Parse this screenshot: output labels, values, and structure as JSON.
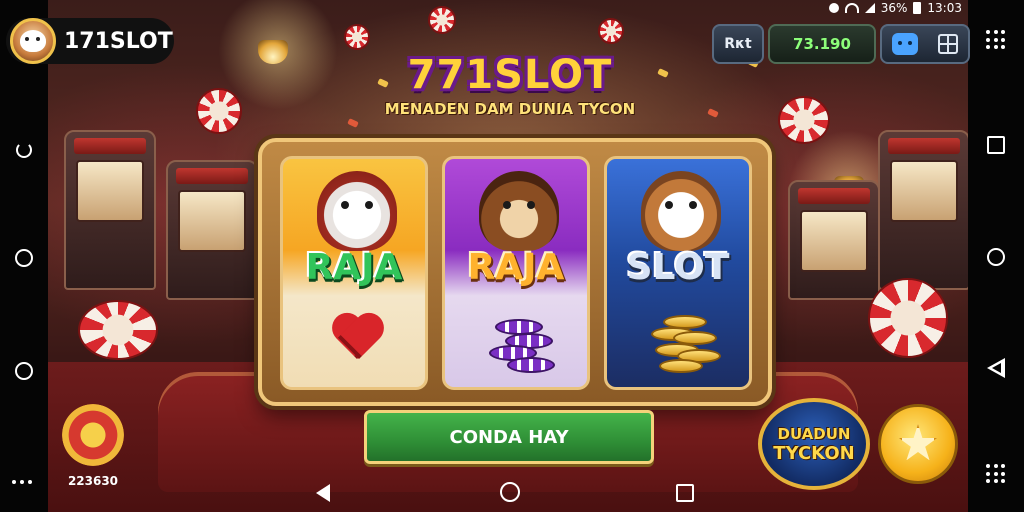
{
  "status_bar": {
    "battery_percent": "36%",
    "time": "13:03"
  },
  "header": {
    "logo_text": "171SLOT"
  },
  "title": {
    "main": "771SLOT",
    "subtitle": "MENADEN DAM DUNIA TYCON"
  },
  "hud": {
    "rkt_label": "Rκt",
    "balance": "73.190",
    "icons": [
      "gamepad-icon",
      "grid-icon"
    ]
  },
  "reels": [
    {
      "word": "RAJA",
      "icon": "heart-icon",
      "theme_color": "#31c45a"
    },
    {
      "word": "RAJA",
      "icon": "chips-icon",
      "theme_color": "#ffb22e"
    },
    {
      "word": "SLOT",
      "icon": "coins-icon",
      "theme_color": "#d7e3f5"
    }
  ],
  "play_button": {
    "label": "CONDA HAY"
  },
  "bottom_left": {
    "badge_value": "223630"
  },
  "tycoon_badge": {
    "line1": "DUADUN",
    "line2": "TYCKON"
  },
  "colors": {
    "accent_gold": "#f0c24b",
    "play_green": "#2f8f36",
    "balance_green": "#8dff7a"
  }
}
